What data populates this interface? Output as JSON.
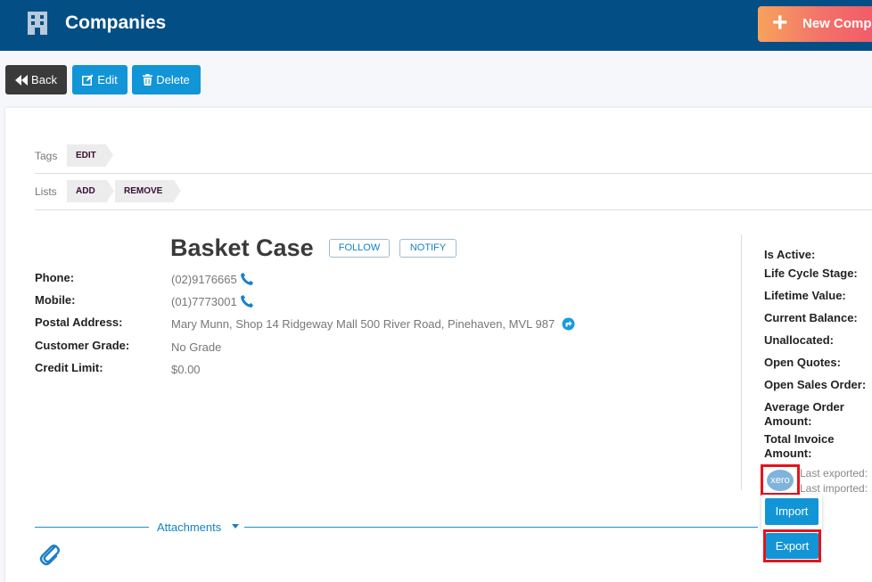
{
  "header": {
    "title": "Companies",
    "new_button": "New Company",
    "accent": "#034f85"
  },
  "toolbar": {
    "back": "Back",
    "edit": "Edit",
    "delete": "Delete"
  },
  "tags_row": {
    "label": "Tags",
    "edit": "EDIT"
  },
  "lists_row": {
    "label": "Lists",
    "add": "ADD",
    "remove": "REMOVE"
  },
  "company": {
    "name": "Basket Case",
    "follow": "FOLLOW",
    "notify": "NOTIFY"
  },
  "fields": {
    "phone": {
      "label": "Phone:",
      "value": "(02)9176665"
    },
    "mobile": {
      "label": "Mobile:",
      "value": "(01)7773001"
    },
    "postal": {
      "label": "Postal Address:",
      "value": "Mary Munn, Shop 14 Ridgeway Mall 500 River Road, Pinehaven, MVL 987"
    },
    "grade": {
      "label": "Customer Grade:",
      "value": "No Grade"
    },
    "credit": {
      "label": "Credit Limit:",
      "value": "$0.00"
    }
  },
  "summary": {
    "is_active": "Is Active:",
    "life_cycle": "Life Cycle Stage:",
    "lifetime_value": "Lifetime Value:",
    "current_balance": "Current Balance:",
    "unallocated": "Unallocated:",
    "open_quotes": "Open Quotes:",
    "open_sales_order": "Open Sales Order:",
    "average_order_1": "Average Order",
    "average_order_2": "Amount:",
    "total_invoice_1": "Total Invoice",
    "total_invoice_2": "Amount:",
    "last_exported": "Last exported:",
    "last_imported": "Last imported:"
  },
  "xero": {
    "logo_text": "xero",
    "import": "Import",
    "export": "Export"
  },
  "attachments": {
    "label": "Attachments"
  }
}
